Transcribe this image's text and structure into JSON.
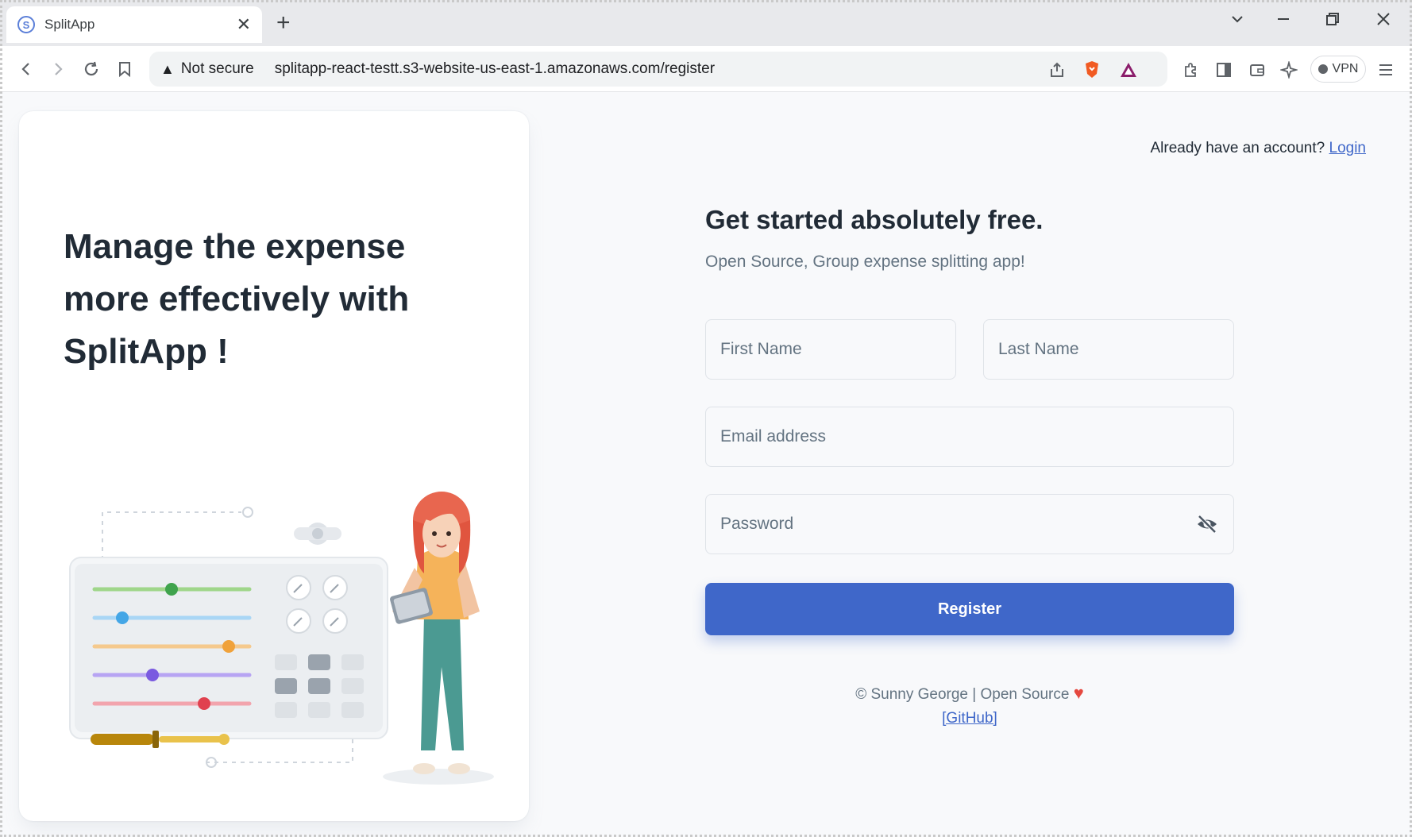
{
  "browser": {
    "tab_title": "SplitApp",
    "tab_close": "✕",
    "new_tab": "+",
    "security_label": "Not secure",
    "url": "splitapp-react-testt.s3-website-us-east-1.amazonaws.com/register",
    "vpn_label": "VPN"
  },
  "left_panel": {
    "heading": "Manage the expense more effectively with SplitApp !"
  },
  "header": {
    "have_account_text": "Already have an account?",
    "login_link": "Login"
  },
  "form": {
    "title": "Get started absolutely free.",
    "subtitle": "Open Source, Group expense splitting app!",
    "first_name_placeholder": "First Name",
    "last_name_placeholder": "Last Name",
    "email_placeholder": "Email address",
    "password_placeholder": "Password",
    "register_label": "Register"
  },
  "footer": {
    "credit": "© Sunny George | Open Source",
    "heart": "♥",
    "github_link": "[GitHub]"
  },
  "colors": {
    "primary": "#3f67c9",
    "background": "#f8f9fb",
    "heart": "#e5483f"
  }
}
